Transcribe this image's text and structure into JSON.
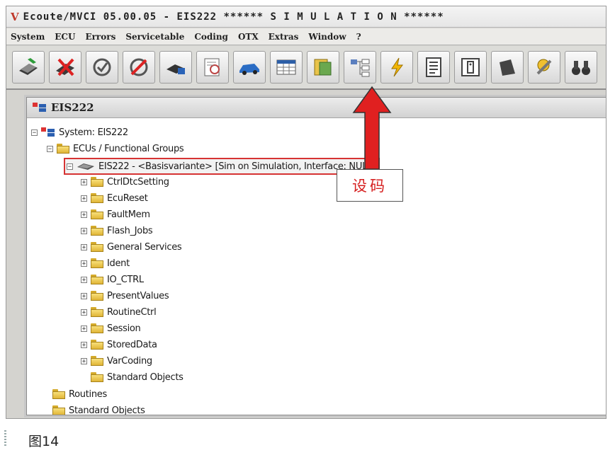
{
  "window": {
    "logo": "V",
    "title": "Ecoute/MVCI 05.00.05 - EIS222 ******  S I M U L A T I O N ******"
  },
  "menu": [
    "System",
    "ECU",
    "Errors",
    "Servicetable",
    "Coding",
    "OTX",
    "Extras",
    "Window",
    "?"
  ],
  "toolbar": {
    "icons": [
      "connect-icon",
      "disconnect-icon",
      "refresh-check-icon",
      "stop-icon",
      "ecu-lock-icon",
      "fault-report-icon",
      "vehicle-icon",
      "data-table-icon",
      "notes-icon",
      "ecu-tree-icon",
      "flash-icon",
      "checklist-icon",
      "info-panel-icon",
      "blank-card-icon",
      "tools-icon",
      "binoculars-icon"
    ]
  },
  "child_window": {
    "title": "EIS222",
    "tree": {
      "system": "System: EIS222",
      "ecu_groups": "ECUs / Functional Groups",
      "ecu_node": "EIS222 - <Basisvariante> [Sim on Simulation, Interface: NULL]",
      "services": [
        "CtrlDtcSetting",
        "EcuReset",
        "FaultMem",
        "Flash_Jobs",
        "General Services",
        "Ident",
        "IO_CTRL",
        "PresentValues",
        "RoutineCtrl",
        "Session",
        "StoredData",
        "VarCoding"
      ],
      "standard_objects_inner": "Standard Objects",
      "routines": "Routines",
      "standard_objects_outer": "Standard Objects"
    }
  },
  "annotation": {
    "callout": "设码",
    "arrow_color": "#e02020"
  },
  "caption": "图14"
}
